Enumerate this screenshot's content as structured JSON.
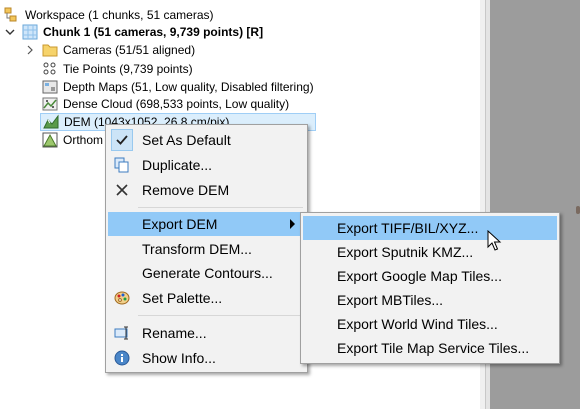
{
  "tree": {
    "workspace": "Workspace (1 chunks, 51 cameras)",
    "chunk": "Chunk 1 (51 cameras, 9,739 points) [R]",
    "items": [
      {
        "label": "Cameras (51/51 aligned)",
        "icon": "folder-icon"
      },
      {
        "label": "Tie Points (9,739 points)",
        "icon": "tie-points-icon"
      },
      {
        "label": "Depth Maps (51, Low quality, Disabled filtering)",
        "icon": "depth-maps-icon"
      },
      {
        "label": "Dense Cloud (698,533 points, Low quality)",
        "icon": "dense-cloud-icon"
      },
      {
        "label": "DEM (1043x1052, 26.8 cm/pix)",
        "icon": "dem-icon"
      },
      {
        "label": "Orthom",
        "icon": "orthomosaic-icon"
      }
    ]
  },
  "context_menu": {
    "items": [
      {
        "label": "Set As Default",
        "icon": "checkmark-icon"
      },
      {
        "label": "Duplicate...",
        "icon": "duplicate-icon"
      },
      {
        "label": "Remove DEM",
        "icon": "close-icon"
      },
      {
        "label": "Export DEM",
        "icon": "",
        "has_submenu": true
      },
      {
        "label": "Transform DEM...",
        "icon": ""
      },
      {
        "label": "Generate Contours...",
        "icon": ""
      },
      {
        "label": "Set Palette...",
        "icon": "palette-icon"
      },
      {
        "label": "Rename...",
        "icon": "rename-icon"
      },
      {
        "label": "Show Info...",
        "icon": "info-icon"
      }
    ]
  },
  "export_submenu": {
    "items": [
      {
        "label": "Export TIFF/BIL/XYZ..."
      },
      {
        "label": "Export Sputnik KMZ..."
      },
      {
        "label": "Export Google Map Tiles..."
      },
      {
        "label": "Export MBTiles..."
      },
      {
        "label": "Export World Wind Tiles..."
      },
      {
        "label": "Export Tile Map Service Tiles..."
      }
    ]
  },
  "colors": {
    "highlight": "#91c9f7",
    "menu_bg": "#f2f2f2",
    "selection_bg": "#dbeefc",
    "panel_gray": "#9c9c9c"
  }
}
